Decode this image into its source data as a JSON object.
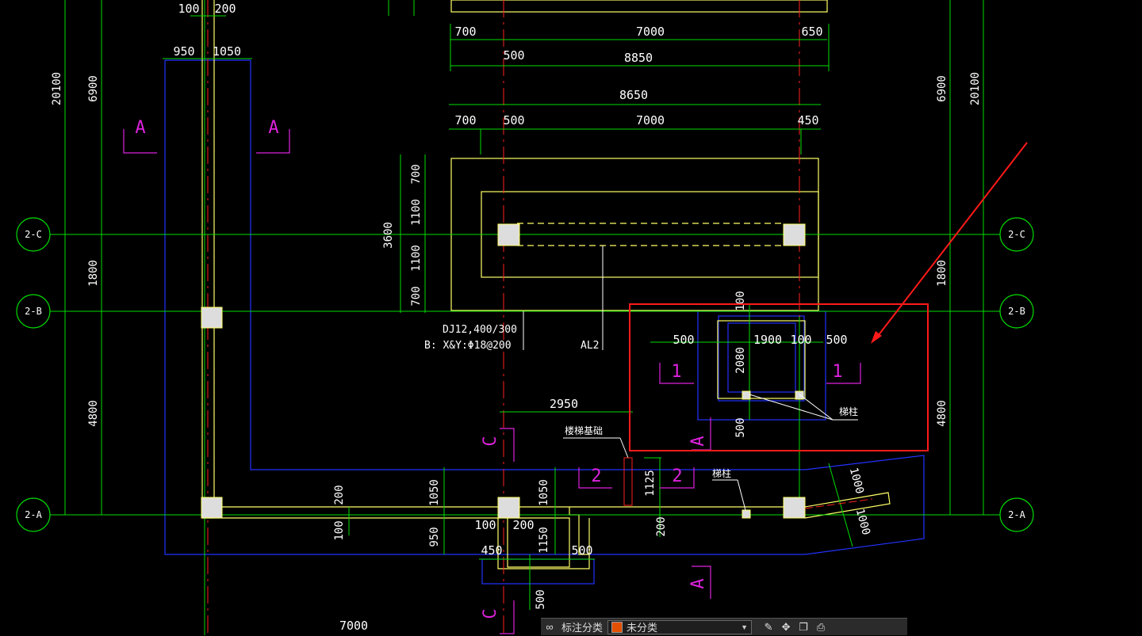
{
  "drawing": {
    "axes": {
      "c": "2-C",
      "b": "2-B",
      "a": "2-A"
    },
    "dims": {
      "d100a": "100",
      "d200a": "200",
      "d950": "950",
      "d1050": "1050",
      "left_20100": "20100",
      "left_6900": "6900",
      "left_1800": "1800",
      "left_4800": "4800",
      "right_20100": "20100",
      "right_6900": "6900",
      "right_1800": "1800",
      "right_4800": "4800",
      "t1_700": "700",
      "t1_7000": "7000",
      "t1_650": "650",
      "t1_500": "500",
      "t1_8850": "8850",
      "t2_8650": "8650",
      "t2_700": "700",
      "t2_500": "500",
      "t2_7000": "7000",
      "t2_450": "450",
      "v_700a": "700",
      "v_1100a": "1100",
      "v_3600": "3600",
      "v_1100b": "1100",
      "v_700b": "700",
      "r_100": "100",
      "r_500a": "500",
      "r_1900": "1900",
      "r_100b": "100",
      "r_500b": "500",
      "r_2080": "2080",
      "r_500c": "500",
      "b_2950": "2950",
      "b_1125": "1125",
      "b_200c": "200",
      "b_200a": "200",
      "b_100a": "100",
      "b_1050": "1050",
      "b_950": "950",
      "b_1050b": "1050",
      "b_100b": "100",
      "b_200b": "200",
      "b_1150": "1150",
      "b_450": "450",
      "b_500": "500",
      "b_500v": "500",
      "s_1000a": "1000",
      "s_1000b": "1000",
      "bottom_7000": "7000"
    },
    "labels": {
      "dj_name": "DJ12,400/300",
      "dj_rebar": "B: X&Y:Φ18@200",
      "beam": "AL2",
      "post1": "梯柱",
      "post2": "梯柱",
      "stair_base": "楼梯基础"
    },
    "sections": {
      "a1": "A",
      "a2": "A",
      "a3": "A",
      "a4": "A",
      "s1a": "1",
      "s1b": "1",
      "s2a": "2",
      "s2b": "2",
      "c1": "C",
      "c2": "C"
    }
  },
  "toolbar": {
    "label": "标注分类",
    "selected": "未分类",
    "swatch_color": "#e35000"
  },
  "colors": {
    "background": "#000000",
    "axis_line": "#ff2020",
    "grid_green": "#00dd00",
    "outline_yellow": "#ffff66",
    "outline_blue": "#2233ff",
    "section_magenta": "#dd22dd",
    "highlight_red": "#ff1a1a"
  }
}
